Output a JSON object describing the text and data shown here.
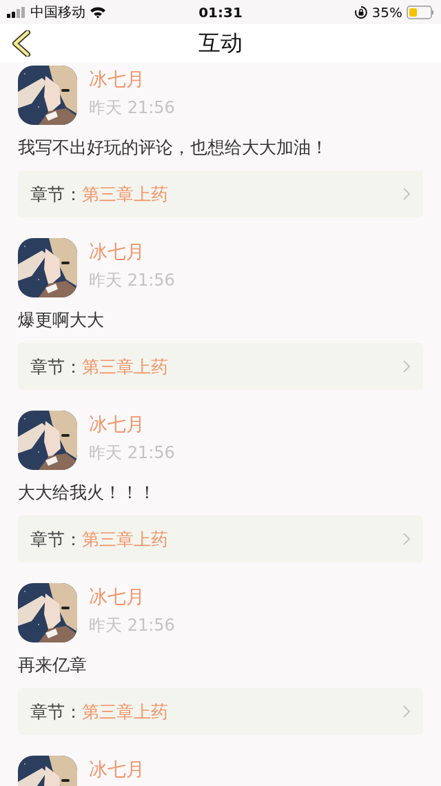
{
  "status_bar": {
    "carrier": "中国移动",
    "time": "01:31",
    "battery": "35%"
  },
  "nav": {
    "title": "互动"
  },
  "comments": [
    {
      "name": "冰七月",
      "time": "昨天 21:56",
      "text": "我写不出好玩的评论，也想给大大加油！",
      "chapter_label": "章节：",
      "chapter": "第三章上药"
    },
    {
      "name": "冰七月",
      "time": "昨天 21:56",
      "text": "爆更啊大大",
      "chapter_label": "章节：",
      "chapter": "第三章上药"
    },
    {
      "name": "冰七月",
      "time": "昨天 21:56",
      "text": "大大给我火！！！",
      "chapter_label": "章节：",
      "chapter": "第三章上药"
    },
    {
      "name": "冰七月",
      "time": "昨天 21:56",
      "text": "再来亿章",
      "chapter_label": "章节：",
      "chapter": "第三章上药"
    },
    {
      "name": "冰七月"
    }
  ]
}
